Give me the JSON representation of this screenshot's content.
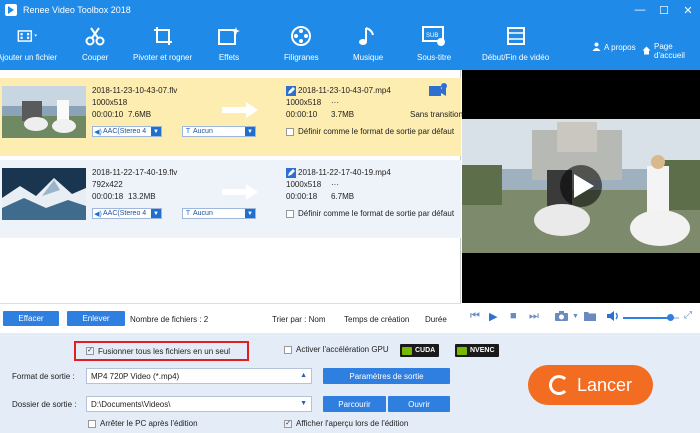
{
  "window": {
    "title": "Renee Video Toolbox 2018",
    "controls": [
      "—",
      "☐",
      "✕"
    ]
  },
  "toolbar": {
    "add_file": "Ajouter un fichier",
    "cut": "Couper",
    "rotate_crop": "Pivoter et rogner",
    "effects": "Effets",
    "watermark": "Filigranes",
    "music": "Musique",
    "subtitle": "Sous-titre",
    "start_end": "Début/Fin de vidéo",
    "about": "A propos",
    "home": "Page d'accueil"
  },
  "files": [
    {
      "src_name": "2018-11-23-10-43-07.flv",
      "src_res": "1000x518",
      "src_time": "00:00:10",
      "src_size": "7.6MB",
      "out_name": "2018-11-23-10-43-07.mp4",
      "out_res": "1000x518",
      "out_extra": "···",
      "out_time": "00:00:10",
      "out_size": "3.7MB",
      "audio": "AAC(Stereo 4",
      "subtitle": "Aucun",
      "set_default": "Définir comme le format de sortie par défaut",
      "transition": "Sans transition"
    },
    {
      "src_name": "2018-11-22-17-40-19.flv",
      "src_res": "792x422",
      "src_time": "00:00:18",
      "src_size": "13.2MB",
      "out_name": "2018-11-22-17-40-19.mp4",
      "out_res": "1000x518",
      "out_extra": "···",
      "out_time": "00:00:18",
      "out_size": "6.7MB",
      "audio": "AAC(Stereo 4",
      "subtitle": "Aucun",
      "set_default": "Définir comme le format de sortie par défaut"
    }
  ],
  "list_footer": {
    "clear": "Effacer",
    "remove": "Enlever",
    "file_count": "Nombre de fichiers : 2",
    "sort_by": "Trier par : Nom",
    "creation_time": "Temps de création",
    "duration": "Durée"
  },
  "options": {
    "merge_label": "Fusionner tous les fichiers en un seul",
    "merge_checked": true,
    "gpu_label": "Activer l'accélération GPU",
    "gpu_checked": false,
    "cuda": "CUDA",
    "nvenc": "NVENC",
    "output_format_label": "Format de sortie :",
    "output_format_value": "MP4 720P Video (*.mp4)",
    "output_params": "Paramètres de sortie",
    "output_folder_label": "Dossier de sortie :",
    "output_folder_value": "D:\\Documents\\Videos\\",
    "browse": "Parcourir",
    "open": "Ouvrir",
    "shutdown_label": "Arrêter le PC après l'édition",
    "shutdown_checked": false,
    "preview_label": "Afficher l'aperçu lors de l'édition",
    "preview_checked": true,
    "run": "Lancer"
  },
  "player": {
    "volume": 0.85
  },
  "colors": {
    "brand": "#1f8ae8",
    "run": "#f26c21",
    "highlight": "#fdedb0",
    "merge_border": "#e02020"
  }
}
